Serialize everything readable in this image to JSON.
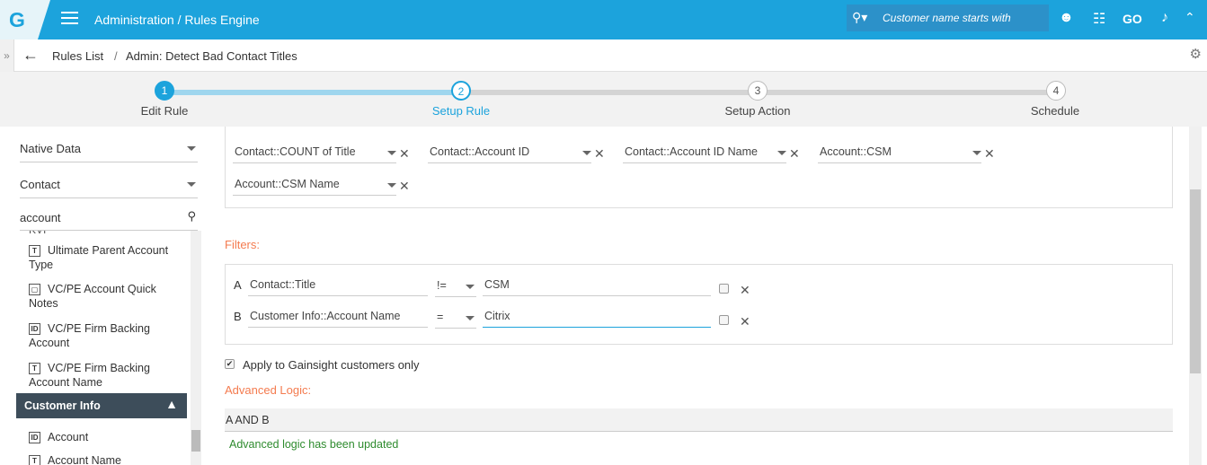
{
  "header": {
    "logo": "G",
    "title": "Administration / Rules Engine",
    "search_placeholder": "Customer name starts with",
    "go": "GO"
  },
  "breadcrumb": {
    "root": "Rules List",
    "separator": "/",
    "current": "Admin: Detect Bad Contact Titles"
  },
  "steps": [
    {
      "num": "1",
      "label": "Edit Rule"
    },
    {
      "num": "2",
      "label": "Setup Rule"
    },
    {
      "num": "3",
      "label": "Setup Action"
    },
    {
      "num": "4",
      "label": "Schedule"
    }
  ],
  "sidebar": {
    "source": "Native Data",
    "object": "Contact",
    "search": "account",
    "items": [
      {
        "icon": "T",
        "label": "Ultimate Parent Account Type"
      },
      {
        "icon": "▢",
        "label": "VC/PE Account Quick Notes"
      },
      {
        "icon": "ID",
        "label": "VC/PE Firm Backing Account"
      },
      {
        "icon": "T",
        "label": "VC/PE Firm Backing Account Name"
      }
    ],
    "group": "Customer Info",
    "group_items": [
      {
        "icon": "ID",
        "label": "Account"
      },
      {
        "icon": "T",
        "label": "Account Name"
      }
    ]
  },
  "fields": [
    "Contact::COUNT of Title",
    "Contact::Account ID",
    "Contact::Account ID Name",
    "Account::CSM",
    "Account::CSM Name"
  ],
  "filters_label": "Filters:",
  "filters": [
    {
      "letter": "A",
      "field": "Contact::Title",
      "op": "!=",
      "value": "CSM"
    },
    {
      "letter": "B",
      "field": "Customer Info::Account Name",
      "op": "=",
      "value": "Citrix"
    }
  ],
  "apply_label": "Apply to Gainsight customers only",
  "advanced_label": "Advanced Logic:",
  "advanced_value": "A AND B",
  "advanced_msg": "Advanced logic has been updated"
}
